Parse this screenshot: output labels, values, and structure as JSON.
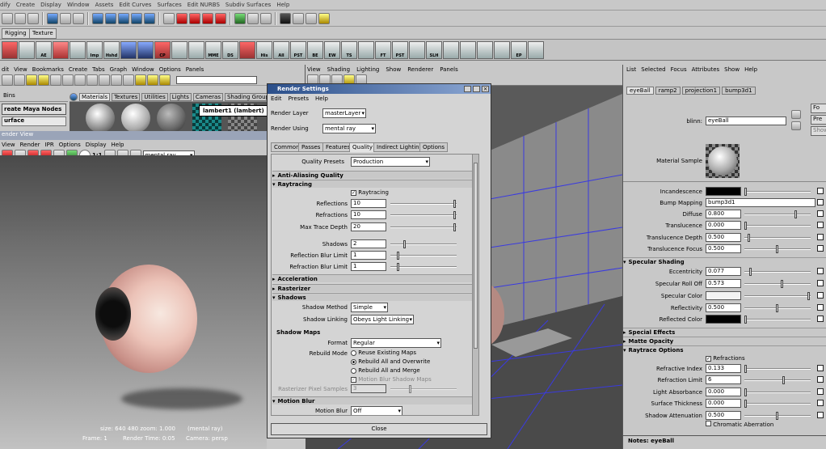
{
  "menubar": {
    "items": [
      "dify",
      "Create",
      "Display",
      "Window",
      "Assets",
      "Edit Curves",
      "Surfaces",
      "Edit NURBS",
      "Subdiv Surfaces",
      "Help"
    ]
  },
  "shelf_tabs": [
    "Rigging",
    "Texture"
  ],
  "shelf_labels": [
    "AE",
    "Imp",
    "Hshd",
    "CP",
    "MME",
    "DS",
    "His",
    "All",
    "PST",
    "BE",
    "EW",
    "TS",
    "FT",
    "PST",
    "SLH",
    "EP"
  ],
  "hypershade": {
    "menu": [
      "dit",
      "View",
      "Bookmarks",
      "Create",
      "Tabs",
      "Graph",
      "Window",
      "Options",
      "Panels"
    ],
    "bins_tab": "Bins",
    "create_button": "reate Maya Nodes",
    "surface_label": "urface",
    "tabs": [
      "Materials",
      "Textures",
      "Utilities",
      "Lights",
      "Cameras",
      "Shading Groups"
    ],
    "tooltip": "lambert1 (lambert)"
  },
  "render_view": {
    "title": "ender View",
    "menu": [
      "View",
      "Render",
      "IPR",
      "Options",
      "Display",
      "Help"
    ],
    "ratio": "1:1",
    "renderer": "mental ray",
    "status1": "size:  640  480  zoom: 1.000",
    "status1b": "(mental ray)",
    "frame": "Frame: 1",
    "render_time": "Render Time: 0:05",
    "camera": "Camera: persp"
  },
  "bg_view": {
    "menu": [
      "View",
      "Shading",
      "Lighting",
      "Show",
      "Renderer",
      "Panels"
    ]
  },
  "render_settings": {
    "title": "Render Settings",
    "menu": [
      "Edit",
      "Presets",
      "Help"
    ],
    "render_layer_label": "Render Layer",
    "render_layer": "masterLayer",
    "render_using_label": "Render Using",
    "render_using": "mental ray",
    "tabs": [
      "Common",
      "Passes",
      "Features",
      "Quality",
      "Indirect Lighting",
      "Options"
    ],
    "quality_presets_label": "Quality Presets",
    "quality_presets": "Production",
    "sections": {
      "aa": "Anti-Aliasing Quality",
      "rt": "Raytracing",
      "acc": "Acceleration",
      "ras": "Rasterizer",
      "sh": "Shadows",
      "smaps": "Shadow Maps",
      "mb": "Motion Blur"
    },
    "raytracing_check": "Raytracing",
    "reflections_label": "Reflections",
    "reflections": "10",
    "refractions_label": "Refractions",
    "refractions": "10",
    "max_trace_label": "Max Trace Depth",
    "max_trace": "20",
    "shadows_label": "Shadows",
    "shadows": "2",
    "refl_blur_label": "Reflection Blur Limit",
    "refl_blur": "1",
    "refr_blur_label": "Refraction Blur Limit",
    "refr_blur": "1",
    "shadow_method_label": "Shadow Method",
    "shadow_method": "Simple",
    "shadow_linking_label": "Shadow Linking",
    "shadow_linking": "Obeys Light Linking",
    "format_label": "Format",
    "format": "Regular",
    "rebuild_label": "Rebuild Mode",
    "rebuild_opts": [
      "Reuse Existing Maps",
      "Rebuild All and Overwrite",
      "Rebuild All and Merge"
    ],
    "mb_shadow_maps": "Motion Blur Shadow Maps",
    "raster_pixel_label": "Rasterizer Pixel Samples",
    "raster_pixel": "3",
    "motion_blur_label": "Motion Blur",
    "motion_blur": "Off",
    "close": "Close"
  },
  "attr_editor": {
    "menu": [
      "List",
      "Selected",
      "Focus",
      "Attributes",
      "Show",
      "Help"
    ],
    "tabs": [
      "eyeBall",
      "ramp2",
      "projection1",
      "bump3d1"
    ],
    "side_buttons": [
      "Fo",
      "Pre",
      "Show"
    ],
    "blinn_label": "blinn:",
    "blinn": "eyeBall",
    "material_sample": "Material Sample",
    "incandescence": "Incandescence",
    "bump_label": "Bump Mapping",
    "bump": "bump3d1",
    "diffuse_label": "Diffuse",
    "diffuse": "0.800",
    "translucence_label": "Translucence",
    "translucence": "0.000",
    "trans_depth_label": "Translucence Depth",
    "trans_depth": "0.500",
    "trans_focus_label": "Translucence Focus",
    "trans_focus": "0.500",
    "spec_section": "Specular Shading",
    "ecc_label": "Eccentricity",
    "ecc": "0.077",
    "roll_label": "Specular Roll Off",
    "roll": "0.573",
    "spec_color_label": "Specular Color",
    "reflectivity_label": "Reflectivity",
    "reflectivity": "0.500",
    "refl_color_label": "Reflected Color",
    "special_effects": "Special Effects",
    "matte_opacity": "Matte Opacity",
    "raytrace_options": "Raytrace Options",
    "refractions_check": "Refractions",
    "ref_index_label": "Refractive Index",
    "ref_index": "0.133",
    "ref_limit_label": "Refraction Limit",
    "ref_limit": "6",
    "light_abs_label": "Light Absorbance",
    "light_abs": "0.000",
    "surf_thick_label": "Surface Thickness",
    "surf_thick": "0.000",
    "shadow_att_label": "Shadow Attenuation",
    "shadow_att": "0.500",
    "chromatic": "Chromatic Aberration",
    "notes": "Notes:  eyeBall"
  },
  "levels": {
    "reflections": 1.0,
    "refractions": 1.0,
    "max_trace": 1.0,
    "shadows": 0.2,
    "refl_blur": 0.1,
    "refr_blur": 0.1,
    "raster": 0.3,
    "diffuse": 0.8,
    "translucence": 0.0,
    "trans_depth": 0.05,
    "trans_focus": 0.5,
    "ecc": 0.077,
    "roll": 0.573,
    "reflectivity": 0.5,
    "ref_index": 0.0,
    "ref_limit": 0.6,
    "shadow_att": 0.5,
    "incandescence": 0.0,
    "spec_color": 1.0,
    "refl_color": 0.0
  },
  "colors": {
    "title_bar": "#2b4f8a",
    "viewport_bg": "#5a5a5a",
    "grid_blue": "#3a3ae0"
  }
}
